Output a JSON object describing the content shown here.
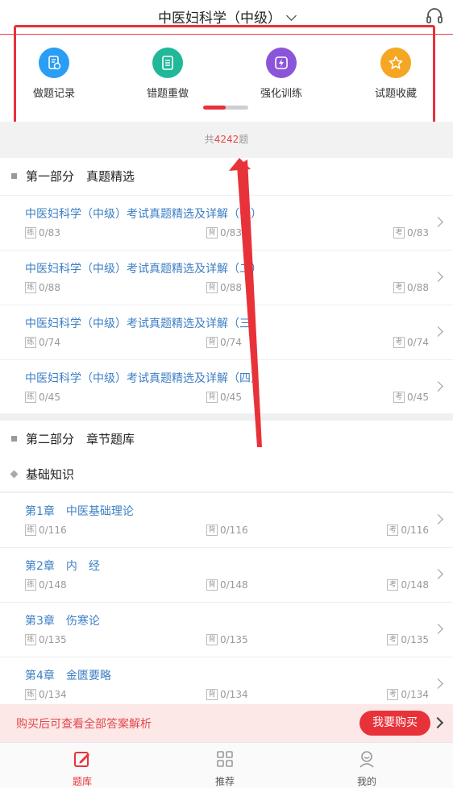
{
  "header": {
    "title": "中医妇科学（中级）"
  },
  "quick_actions": [
    {
      "label": "做题记录",
      "color": "#2a9df4"
    },
    {
      "label": "错题重做",
      "color": "#21b89a"
    },
    {
      "label": "强化训练",
      "color": "#8b55d9"
    },
    {
      "label": "试题收藏",
      "color": "#f5a623"
    }
  ],
  "total": {
    "prefix": "共",
    "count": "4242",
    "suffix": "题"
  },
  "tags": {
    "practice": "练",
    "recite": "背",
    "exam": "考"
  },
  "part1": {
    "title": "第一部分　真题精选",
    "items": [
      {
        "title": "中医妇科学（中级）考试真题精选及详解（一）",
        "practice": "0/83",
        "recite": "0/83",
        "exam": "0/83"
      },
      {
        "title": "中医妇科学（中级）考试真题精选及详解（二）",
        "practice": "0/88",
        "recite": "0/88",
        "exam": "0/88"
      },
      {
        "title": "中医妇科学（中级）考试真题精选及详解（三）",
        "practice": "0/74",
        "recite": "0/74",
        "exam": "0/74"
      },
      {
        "title": "中医妇科学（中级）考试真题精选及详解（四）",
        "practice": "0/45",
        "recite": "0/45",
        "exam": "0/45"
      }
    ]
  },
  "part2": {
    "title": "第二部分　章节题库",
    "subsection": "基础知识",
    "items": [
      {
        "title": "第1章　中医基础理论",
        "practice": "0/116",
        "recite": "0/116",
        "exam": "0/116"
      },
      {
        "title": "第2章　内　经",
        "practice": "0/148",
        "recite": "0/148",
        "exam": "0/148"
      },
      {
        "title": "第3章　伤寒论",
        "practice": "0/135",
        "recite": "0/135",
        "exam": "0/135"
      },
      {
        "title": "第4章　金匮要略",
        "practice": "0/134",
        "recite": "0/134",
        "exam": "0/134"
      }
    ]
  },
  "purchase": {
    "text": "购买后可查看全部答案解析",
    "button": "我要购买"
  },
  "tabs": [
    {
      "label": "题库",
      "active": true
    },
    {
      "label": "推荐",
      "active": false
    },
    {
      "label": "我的",
      "active": false
    }
  ],
  "colors": {
    "accent": "#e8323a",
    "link": "#3d7fc4"
  }
}
